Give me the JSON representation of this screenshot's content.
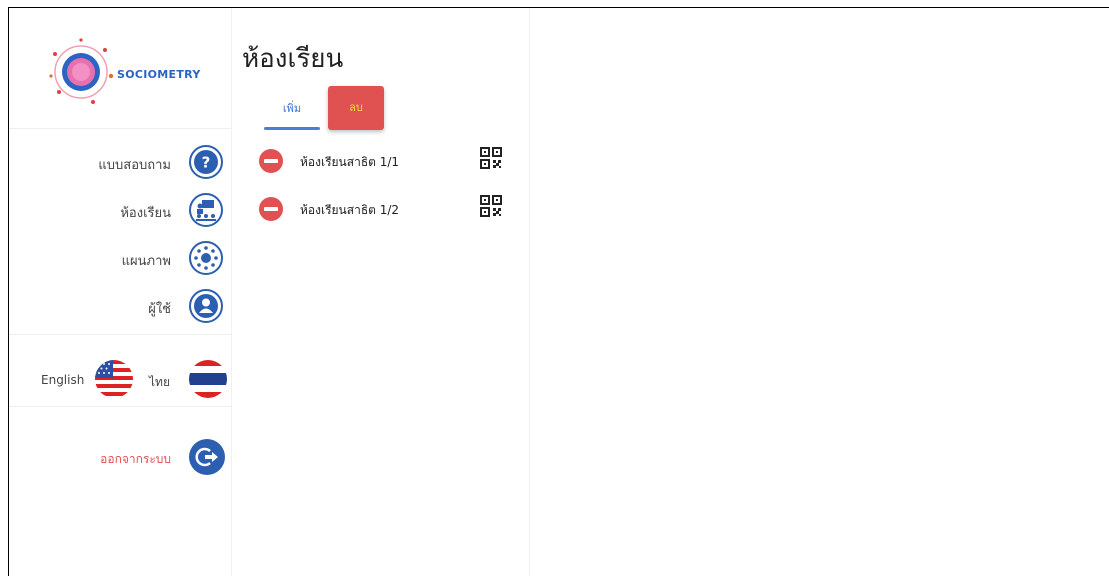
{
  "app": {
    "logo_text": "SOCIOMETRY"
  },
  "sidebar": {
    "items": [
      {
        "label": "แบบสอบถาม",
        "icon": "question-icon"
      },
      {
        "label": "ห้องเรียน",
        "icon": "classroom-icon"
      },
      {
        "label": "แผนภาพ",
        "icon": "network-icon"
      },
      {
        "label": "ผู้ใช้",
        "icon": "user-icon"
      }
    ],
    "languages": {
      "english_label": "English",
      "thai_label": "ไทย"
    },
    "logout_label": "ออกจากระบบ"
  },
  "main": {
    "title": "ห้องเรียน",
    "add_label": "เพิ่ม",
    "delete_label": "ลบ",
    "rooms": [
      {
        "name": "ห้องเรียนสาธิต 1/1"
      },
      {
        "name": "ห้องเรียนสาธิต 1/2"
      }
    ]
  },
  "colors": {
    "primary": "#2c5fb0",
    "danger": "#e05252",
    "accent": "#3a74d8"
  }
}
